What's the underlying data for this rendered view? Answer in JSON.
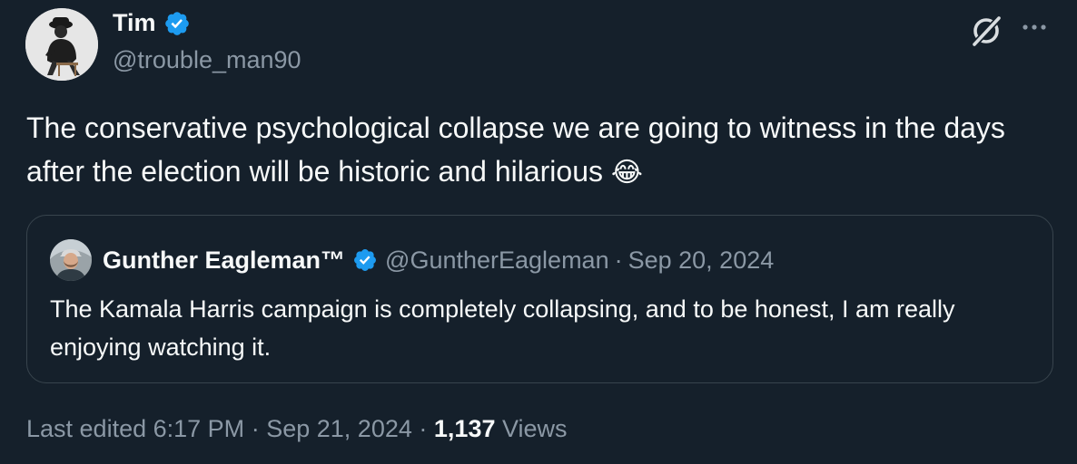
{
  "author": {
    "name": "Tim",
    "handle": "@trouble_man90",
    "verified_color": "#1d9bf0"
  },
  "icons": {
    "grok": "grok-icon",
    "more": "more-icon",
    "verified": "verified-badge-icon"
  },
  "tweet": {
    "text": "The conservative psychological collapse we are going to witness in the days after the election will be historic and hilarious",
    "emoji": "😂"
  },
  "quote": {
    "name": "Gunther Eagleman™",
    "handle": "@GuntherEagleman",
    "separator": "·",
    "date": "Sep 20, 2024",
    "text": "The Kamala Harris campaign is completely collapsing, and to be honest, I am really enjoying watching it."
  },
  "footer": {
    "edited_label": "Last edited",
    "time": "6:17 PM",
    "separator": "·",
    "date": "Sep 21, 2024",
    "views_count": "1,137",
    "views_label": "Views"
  },
  "colors": {
    "background": "#15202b",
    "text_primary": "#f7f9f9",
    "text_secondary": "#8b98a5",
    "border": "#38444d",
    "accent": "#1d9bf0"
  }
}
